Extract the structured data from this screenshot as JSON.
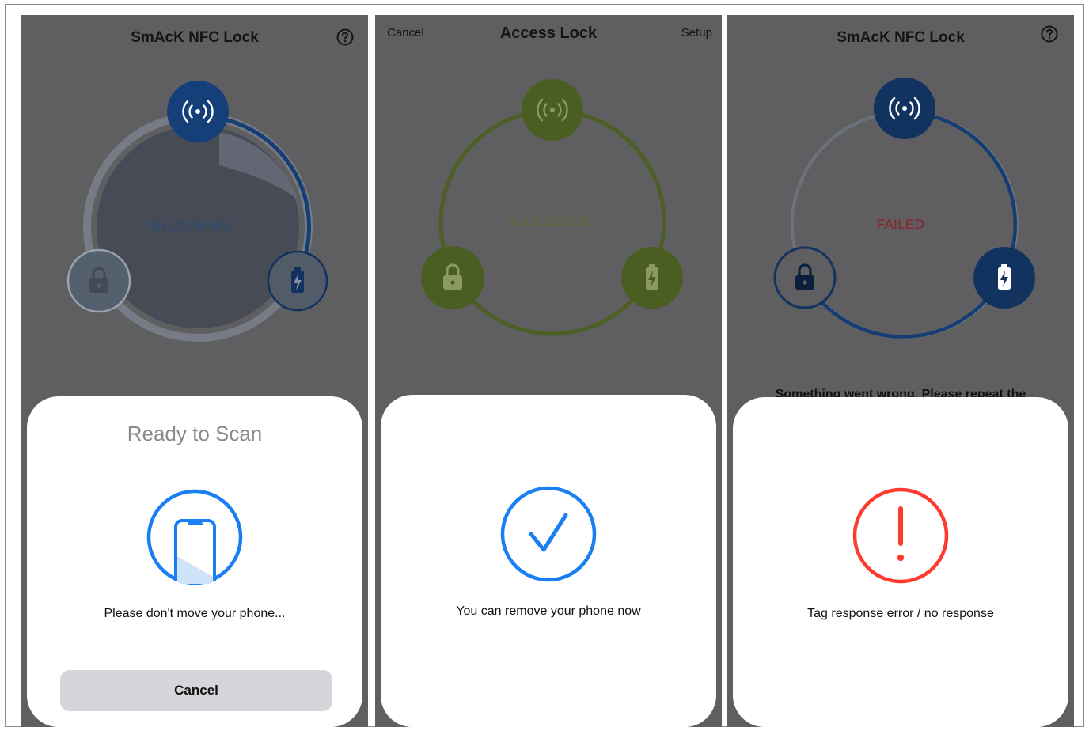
{
  "screens": [
    {
      "nav_title": "SmAcK NFC Lock",
      "help_icon": "question-circle-icon",
      "status": "UNLOCKING...",
      "sheet": {
        "title": "Ready to Scan",
        "icon": "phone-scan-icon",
        "message": "Please don't move your phone...",
        "button": "Cancel"
      }
    },
    {
      "nav_left": "Cancel",
      "nav_title": "Access Lock",
      "nav_right": "Setup",
      "status": "SUCCEEDED",
      "sheet": {
        "icon": "checkmark-icon",
        "message": "You can remove your phone now"
      }
    },
    {
      "nav_title": "SmAcK NFC Lock",
      "help_icon": "question-circle-icon",
      "status": "FAILED",
      "background_message": "Something went wrong. Please repeat the",
      "sheet": {
        "icon": "exclamation-icon",
        "message": "Tag response error / no response"
      }
    }
  ],
  "icons": [
    "nfc-icon",
    "lock-icon",
    "battery-charging-icon"
  ],
  "colors": {
    "nfc_blue": "#143f78",
    "success_green": "#4a5e22",
    "failure_red": "#ff3b30",
    "ios_blue": "#1a7ff2",
    "overlay": "#5f5e60"
  }
}
